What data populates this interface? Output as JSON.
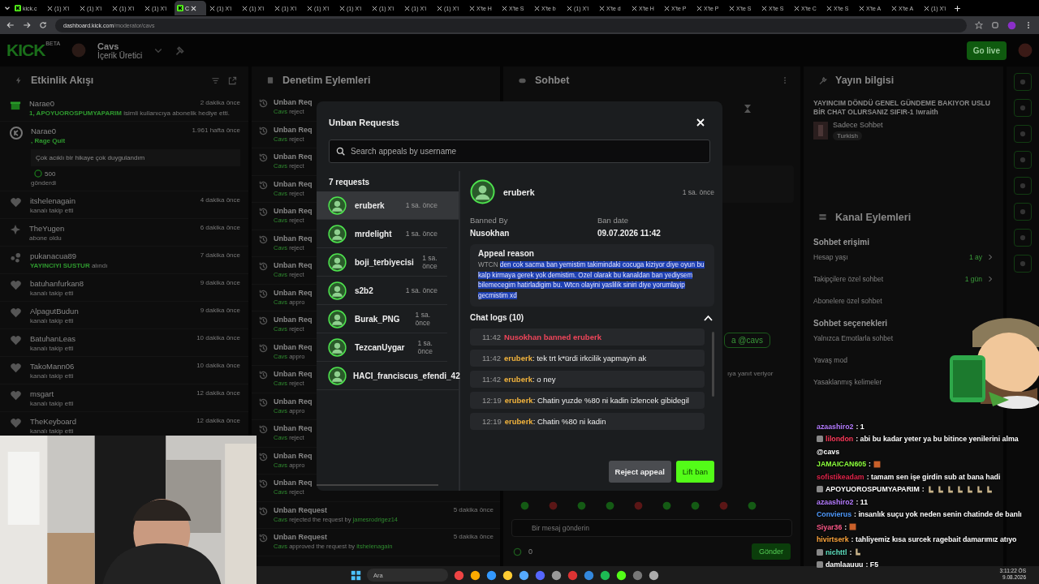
{
  "browser": {
    "tabs": [
      {
        "label": "kick.c",
        "kind": "kick",
        "selected": false
      },
      {
        "label": "(1) X'i",
        "kind": "x",
        "selected": false
      },
      {
        "label": "(1) X'i",
        "kind": "x",
        "selected": false
      },
      {
        "label": "(1) X'i",
        "kind": "x",
        "selected": false
      },
      {
        "label": "(1) X'i",
        "kind": "x",
        "selected": false
      },
      {
        "label": "C",
        "kind": "kick",
        "selected": true
      },
      {
        "label": "(1) X'i",
        "kind": "x",
        "selected": false
      },
      {
        "label": "(1) X'i",
        "kind": "x",
        "selected": false
      },
      {
        "label": "(1) X'i",
        "kind": "x",
        "selected": false
      },
      {
        "label": "(1) X'i",
        "kind": "x",
        "selected": false
      },
      {
        "label": "(1) X'i",
        "kind": "x",
        "selected": false
      },
      {
        "label": "(1) X'i",
        "kind": "x",
        "selected": false
      },
      {
        "label": "(1) X'i",
        "kind": "x",
        "selected": false
      },
      {
        "label": "(1) X'i",
        "kind": "x",
        "selected": false
      },
      {
        "label": "X'te H",
        "kind": "x",
        "selected": false
      },
      {
        "label": "X'te S",
        "kind": "x",
        "selected": false
      },
      {
        "label": "X'te b",
        "kind": "x",
        "selected": false
      },
      {
        "label": "(1) X'i",
        "kind": "x",
        "selected": false
      },
      {
        "label": "X'te d",
        "kind": "x",
        "selected": false
      },
      {
        "label": "X'te H",
        "kind": "x",
        "selected": false
      },
      {
        "label": "X'te P",
        "kind": "x",
        "selected": false
      },
      {
        "label": "X'te P",
        "kind": "x",
        "selected": false
      },
      {
        "label": "X'te S",
        "kind": "x",
        "selected": false
      },
      {
        "label": "X'te S",
        "kind": "x",
        "selected": false
      },
      {
        "label": "X'te C",
        "kind": "x",
        "selected": false
      },
      {
        "label": "X'te S",
        "kind": "x",
        "selected": false
      },
      {
        "label": "X'te A",
        "kind": "x",
        "selected": false
      },
      {
        "label": "X'te A",
        "kind": "x",
        "selected": false
      },
      {
        "label": "(1) X'i",
        "kind": "x",
        "selected": false
      }
    ],
    "address": {
      "host": "dashboard.kick.com",
      "path": "/moderator/cavs"
    }
  },
  "header": {
    "logo": "KICK",
    "logo_badge": "BETA",
    "channel": "Cavs",
    "role": "İçerik Üretici",
    "go_live": "Go live"
  },
  "activity": {
    "title": "Etkinlik Akışı",
    "events": [
      {
        "kind": "gift",
        "user": "Narae0",
        "time": "2 dakika önce",
        "highlight": "1, APOYUOROSPUMYAPARIM",
        "text": "isimli kullanıcıya abonelik hediye etti."
      },
      {
        "kind": "coins",
        "user": "Narae0",
        "time": "1.961 hafta önce",
        "highlight": ", Rage Quit",
        "message": "Çok acıklı bir hikaye çok duygulandım",
        "amount": "500",
        "footer": "gönderdi"
      },
      {
        "kind": "follow",
        "user": "itshelenagain",
        "time": "4 dakika önce",
        "text": "kanalı takip etti"
      },
      {
        "kind": "sub",
        "user": "TheYugen",
        "time": "6 dakika önce",
        "text": "abone oldu"
      },
      {
        "kind": "reward",
        "user": "pukanacua89",
        "time": "7 dakika önce",
        "highlight": "YAYINCIYI SUSTUR",
        "text": "alındı"
      },
      {
        "kind": "follow",
        "user": "batuhanfurkan8",
        "time": "9 dakika önce",
        "text": "kanalı takip etti"
      },
      {
        "kind": "follow",
        "user": "AlpagutBudun",
        "time": "9 dakika önce",
        "text": "kanalı takip etti"
      },
      {
        "kind": "follow",
        "user": "BatuhanLeas",
        "time": "10 dakika önce",
        "text": "kanalı takip etti"
      },
      {
        "kind": "follow",
        "user": "TakoMann06",
        "time": "10 dakika önce",
        "text": "kanalı takip etti"
      },
      {
        "kind": "follow",
        "user": "msgart",
        "time": "12 dakika önce",
        "text": "kanalı takip etti"
      },
      {
        "kind": "follow",
        "user": "TheKeyboard",
        "time": "12 dakika önce",
        "text": "kanalı takip etti"
      }
    ]
  },
  "moderation": {
    "title": "Denetim Eylemleri",
    "rows": [
      {
        "title": "Unban Req",
        "actor": "Cavs",
        "action": "reject"
      },
      {
        "title": "Unban Req",
        "actor": "Cavs",
        "action": "reject"
      },
      {
        "title": "Unban Req",
        "actor": "Cavs",
        "action": "reject"
      },
      {
        "title": "Unban Req",
        "actor": "Cavs",
        "action": "reject"
      },
      {
        "title": "Unban Req",
        "actor": "Cavs",
        "action": "reject"
      },
      {
        "title": "Unban Req",
        "actor": "Cavs",
        "action": "reject"
      },
      {
        "title": "Unban Req",
        "actor": "Cavs",
        "action": "reject"
      },
      {
        "title": "Unban Req",
        "actor": "Cavs",
        "action": "appro"
      },
      {
        "title": "Unban Req",
        "actor": "Cavs",
        "action": "reject"
      },
      {
        "title": "Unban Req",
        "actor": "Cavs",
        "action": "appro"
      },
      {
        "title": "Unban Req",
        "actor": "Cavs",
        "action": "reject"
      },
      {
        "title": "Unban Req",
        "actor": "Cavs",
        "action": "appro"
      },
      {
        "title": "Unban Req",
        "actor": "Cavs",
        "action": "reject"
      },
      {
        "title": "Unban Req",
        "actor": "Cavs",
        "action": "appro"
      },
      {
        "title": "Unban Req",
        "actor": "Cavs",
        "action": "reject"
      },
      {
        "title": "Unban Request",
        "actor": "Cavs",
        "action": "rejected the request by",
        "target": "jamesrodrigez14",
        "time": "5 dakika önce"
      },
      {
        "title": "Unban Request",
        "actor": "Cavs",
        "action": "approved the request by",
        "target": "itshelenagain",
        "time": "5 dakika önce"
      }
    ]
  },
  "chat": {
    "title": "Sohbet",
    "reply_fragment": "a @cavs",
    "hint_fragment": "ıya yanıt veriyor",
    "input": {
      "placeholder": "Bir mesaj gönderin"
    },
    "points": "0",
    "send": "Gönder"
  },
  "stream_info": {
    "title": "Yayın bilgisi",
    "stream_title": "YAYINCIM DÖNDÜ GENEL GÜNDEME BAKIYOR USLU BİR CHAT OLURSANIZ SIFIR-1 !wraith",
    "category": "Sadece Sohbet",
    "tag": "Turkish"
  },
  "channel_actions": {
    "title": "Kanal Eylemleri",
    "sections": [
      {
        "heading": "Sohbet erişimi",
        "items": [
          {
            "label": "Hesap yaşı",
            "value": "1 ay"
          },
          {
            "label": "Takipçilere özel sohbet",
            "value": "1 gün"
          },
          {
            "label": "Abonelere özel sohbet"
          }
        ]
      },
      {
        "heading": "Sohbet seçenekleri",
        "items": [
          {
            "label": "Yalnızca Emotlarla sohbet"
          },
          {
            "label": "Yavaş mod"
          },
          {
            "label": "Yasaklanmış kelimeler"
          }
        ]
      }
    ]
  },
  "modal": {
    "title": "Unban Requests",
    "search": {
      "placeholder": "Search appeals by username"
    },
    "count": "7 requests",
    "requests": [
      {
        "name": "eruberk",
        "time": "1 sa. önce",
        "selected": true
      },
      {
        "name": "mrdelight",
        "time": "1 sa. önce",
        "selected": false
      },
      {
        "name": "boji_terbiyecisi",
        "time": "1 sa. önce",
        "selected": false
      },
      {
        "name": "s2b2",
        "time": "1 sa. önce",
        "selected": false
      },
      {
        "name": "Burak_PNG",
        "time": "1 sa. önce",
        "selected": false
      },
      {
        "name": "TezcanUygar",
        "time": "1 sa. önce",
        "selected": false
      },
      {
        "name": "HACI_franciscus_efendi_42",
        "selected": false
      }
    ],
    "detail": {
      "name": "eruberk",
      "time": "1 sa. önce",
      "banned_by_label": "Banned By",
      "banned_by": "Nusokhan",
      "ban_date_label": "Ban date",
      "ban_date": "09.07.2026 11:42",
      "appeal_label": "Appeal reason",
      "appeal_prefix": "WTCN",
      "appeal_highlighted": "den cok sacma ban yemistim takimindaki cocuga kiziyor diye oyun bu kalp kirmaya gerek yok demistim. Ozel olarak bu kanaldan ban yediysem bilemecegim hatirladigim bu. Wtcn olayini yaslilik siniri diye yorumlayip gecmistim xd",
      "logs_label": "Chat logs (10)",
      "logs_expanded": true,
      "logs": [
        {
          "kind": "ban",
          "time": "11:42",
          "text": "Nusokhan banned eruberk"
        },
        {
          "kind": "message",
          "time": "11:42",
          "user": "eruberk",
          "text": ": tek trt k*ürdi irkcilik yapmayin ak"
        },
        {
          "kind": "message",
          "time": "11:42",
          "user": "eruberk",
          "text": ": o ney"
        },
        {
          "kind": "message",
          "time": "12:19",
          "user": "eruberk",
          "text": ": Chatin yuzde %80 ni kadin izlencek gibidegil"
        },
        {
          "kind": "message",
          "time": "12:19",
          "user": "eruberk",
          "text": ": Chatin %80 ni kadin"
        }
      ]
    },
    "buttons": [
      {
        "label": "Reject appeal",
        "kind": "secondary"
      },
      {
        "label": "Lift ban",
        "kind": "primary"
      }
    ]
  },
  "stream_chat": [
    {
      "user": "azaashiro2",
      "color": "#b57cff",
      "text": ": 1"
    },
    {
      "user": "lilondon",
      "color": "#ff3b5c",
      "badge": true,
      "text": ": abi bu kadar yeter ya bu bitince yenilerini alma"
    },
    {
      "text": "@cavs"
    },
    {
      "user": "JAMAICAN605",
      "color": "#8cff3c",
      "text": ":",
      "kind": "emote"
    },
    {
      "user": "sofistikeadam",
      "color": "#e0244a",
      "text": ": tamam sen işe girdin sub at bana hadi"
    },
    {
      "user": "APOYUOROSPUMYAPARIM",
      "color": "#ffffff",
      "badge": true,
      "text": ":",
      "kind": "emote_row"
    },
    {
      "user": "azaashiro2",
      "color": "#b57cff",
      "text": ": 11"
    },
    {
      "user": "Convierus",
      "color": "#4f9bff",
      "text": ": insanlık suçu yok neden senin chatinde de banlı"
    },
    {
      "user": "Siyar36",
      "color": "#ff5a8a",
      "text": ":",
      "kind": "emote"
    },
    {
      "user": "hivirtserk",
      "color": "#ffa63c",
      "text": ": tahliyemiz kısa surcek ragebait damarımız atıyo"
    },
    {
      "user": "nichttl",
      "color": "#5fe0c0",
      "badge": true,
      "text": ":",
      "kind": "emote_small"
    },
    {
      "user": "damlaauuu",
      "color": "#ffffff",
      "badge": true,
      "text": ": F5"
    }
  ],
  "taskbar": {
    "search": "Ara",
    "time": "3:11:22 ÖS",
    "date": "9.08.2026"
  }
}
